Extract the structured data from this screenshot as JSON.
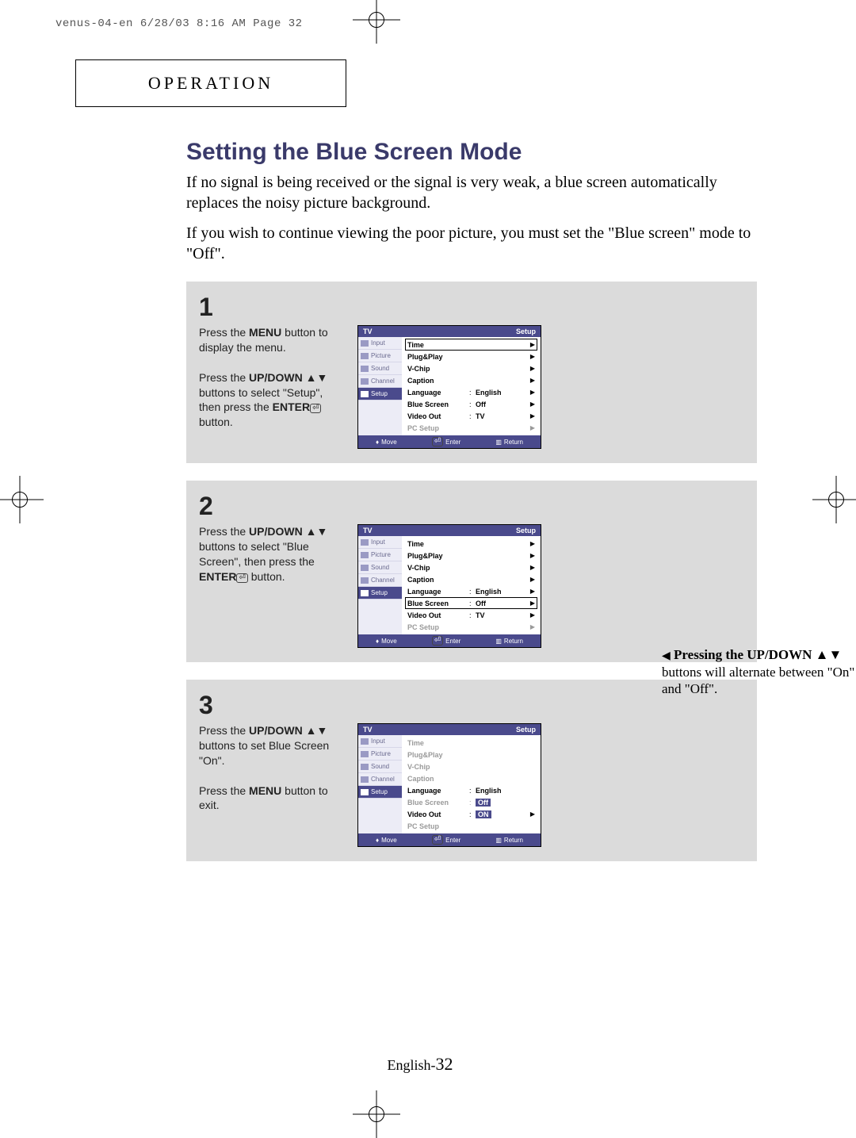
{
  "slug": "venus-04-en  6/28/03  8:16 AM  Page 32",
  "section_header": "OPERATION",
  "title": "Setting the Blue Screen Mode",
  "intro_1": "If no signal is being received or the signal is very weak, a blue screen automatically replaces the noisy picture background.",
  "intro_2": "If you wish to continue viewing the poor picture, you must set the \"Blue screen\" mode to \"Off\".",
  "steps": [
    {
      "num": "1",
      "text_parts": [
        "Press the ",
        "MENU",
        " button to display the menu.",
        "Press the ",
        "UP/DOWN",
        " ▲▼ buttons to select \"Setup\", then press the ",
        "ENTER",
        " button."
      ]
    },
    {
      "num": "2",
      "text_parts": [
        "Press the ",
        "UP/DOWN",
        " ▲▼ buttons to select \"Blue Screen\", then press the ",
        "ENTER",
        " button."
      ]
    },
    {
      "num": "3",
      "text_parts": [
        "Press the ",
        "UP/DOWN",
        " ▲▼ buttons to set Blue Screen \"On\".",
        "Press the ",
        "MENU",
        " button to exit."
      ]
    }
  ],
  "osd": {
    "head_left": "TV",
    "head_right": "Setup",
    "side_items": [
      "Input",
      "Picture",
      "Sound",
      "Channel",
      "Setup"
    ],
    "rows": [
      {
        "label": "Time",
        "val": "",
        "arrow": "▶"
      },
      {
        "label": "Plug&Play",
        "val": "",
        "arrow": "▶"
      },
      {
        "label": "V-Chip",
        "val": "",
        "arrow": "▶"
      },
      {
        "label": "Caption",
        "val": "",
        "arrow": "▶"
      },
      {
        "label": "Language",
        "val": "English",
        "sep": ":",
        "arrow": "▶"
      },
      {
        "label": "Blue Screen",
        "val": "Off",
        "sep": ":",
        "arrow": "▶"
      },
      {
        "label": "Video Out",
        "val": "TV",
        "sep": ":",
        "arrow": "▶"
      },
      {
        "label": "PC Setup",
        "val": "",
        "arrow": "▶"
      }
    ],
    "foot": {
      "move": "Move",
      "enter": "Enter",
      "return": "Return"
    }
  },
  "osd3_blue_val": "Off",
  "osd3_video_val": "ON",
  "note_prefix": "◀",
  "note_bold": "Pressing the UP/DOWN ▲▼",
  "note_rest": "buttons will alternate between \"On\" and \"Off\".",
  "page_label_prefix": "English-",
  "page_number": "32"
}
